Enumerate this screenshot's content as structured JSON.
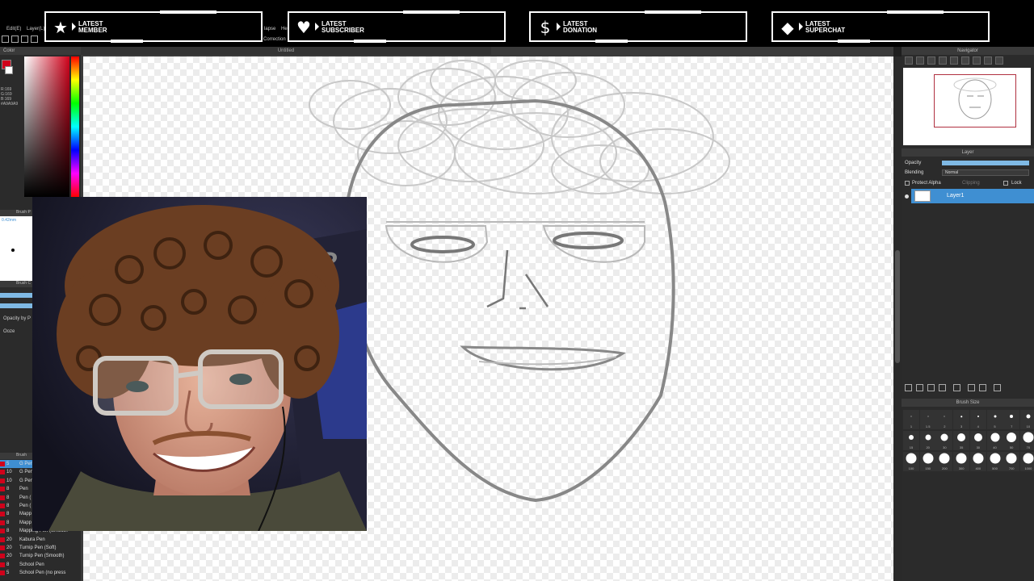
{
  "overlay": {
    "alerts": [
      {
        "label": "LATEST MEMBER",
        "icon": "star-icon"
      },
      {
        "label": "LATEST SUBSCRIBER",
        "icon": "heart-icon"
      },
      {
        "label": "LATEST DONATION",
        "icon": "dollar-icon"
      },
      {
        "label": "LATEST SUPERCHAT",
        "icon": "diamond-icon"
      }
    ]
  },
  "menu": {
    "edit": "Edit(E)",
    "layer": "Layer(L)",
    "lapse": "lapse",
    "help": "He",
    "correction": "Correction"
  },
  "canvas": {
    "title": "Untitled"
  },
  "left_panel": {
    "color_title": "Color",
    "rgb_values": [
      "R:169",
      "G:169",
      "B:169",
      "#A9A9A9"
    ],
    "brush_prev_title": "Brush P",
    "brush_size_text": "0.42mm",
    "brush_ctrl_title": "Brush C",
    "opacity_label": "Opacity by P",
    "ooze_label": "Ooze",
    "brush_title": "Brush",
    "brushes": [
      {
        "size": "5",
        "name": "G Pen",
        "selected": true
      },
      {
        "size": "10",
        "name": "G Pen",
        "selected": false
      },
      {
        "size": "10",
        "name": "G Pen",
        "selected": false
      },
      {
        "size": "8",
        "name": "Pen",
        "selected": false
      },
      {
        "size": "8",
        "name": "Pen (",
        "selected": false
      },
      {
        "size": "8",
        "name": "Pen (",
        "selected": false
      },
      {
        "size": "8",
        "name": "Mapp",
        "selected": false
      },
      {
        "size": "8",
        "name": "Mapp",
        "selected": false
      },
      {
        "size": "8",
        "name": "Mapping Pen (Smooth",
        "selected": false
      },
      {
        "size": "20",
        "name": "Kabura Pen",
        "selected": false
      },
      {
        "size": "20",
        "name": "Turnip Pen (Soft)",
        "selected": false
      },
      {
        "size": "20",
        "name": "Turnip Pen (Smooth)",
        "selected": false
      },
      {
        "size": "8",
        "name": "School Pen",
        "selected": false
      },
      {
        "size": "5",
        "name": "School Pen (no press",
        "selected": false
      }
    ]
  },
  "right_panel": {
    "navigator_title": "Navigator",
    "layer_title": "Layer",
    "opacity_label": "Opacity",
    "opacity_value": 1.0,
    "blending_label": "Blending",
    "blending_value": "Normal",
    "protect_alpha": "Protect Alpha",
    "clipping": "Clipping",
    "lock": "Lock",
    "layer_name": "Layer1",
    "brush_size_title": "Brush Size",
    "sizes_row1": [
      "1",
      "1.5",
      "2",
      "3",
      "4",
      "5",
      "7",
      "10"
    ],
    "sizes_row2": [
      "15",
      "20",
      "30",
      "35",
      "30",
      "40",
      "50",
      "70"
    ],
    "sizes_row3": [
      "100",
      "150",
      "200",
      "300",
      "400",
      "500",
      "700",
      "1000"
    ]
  }
}
